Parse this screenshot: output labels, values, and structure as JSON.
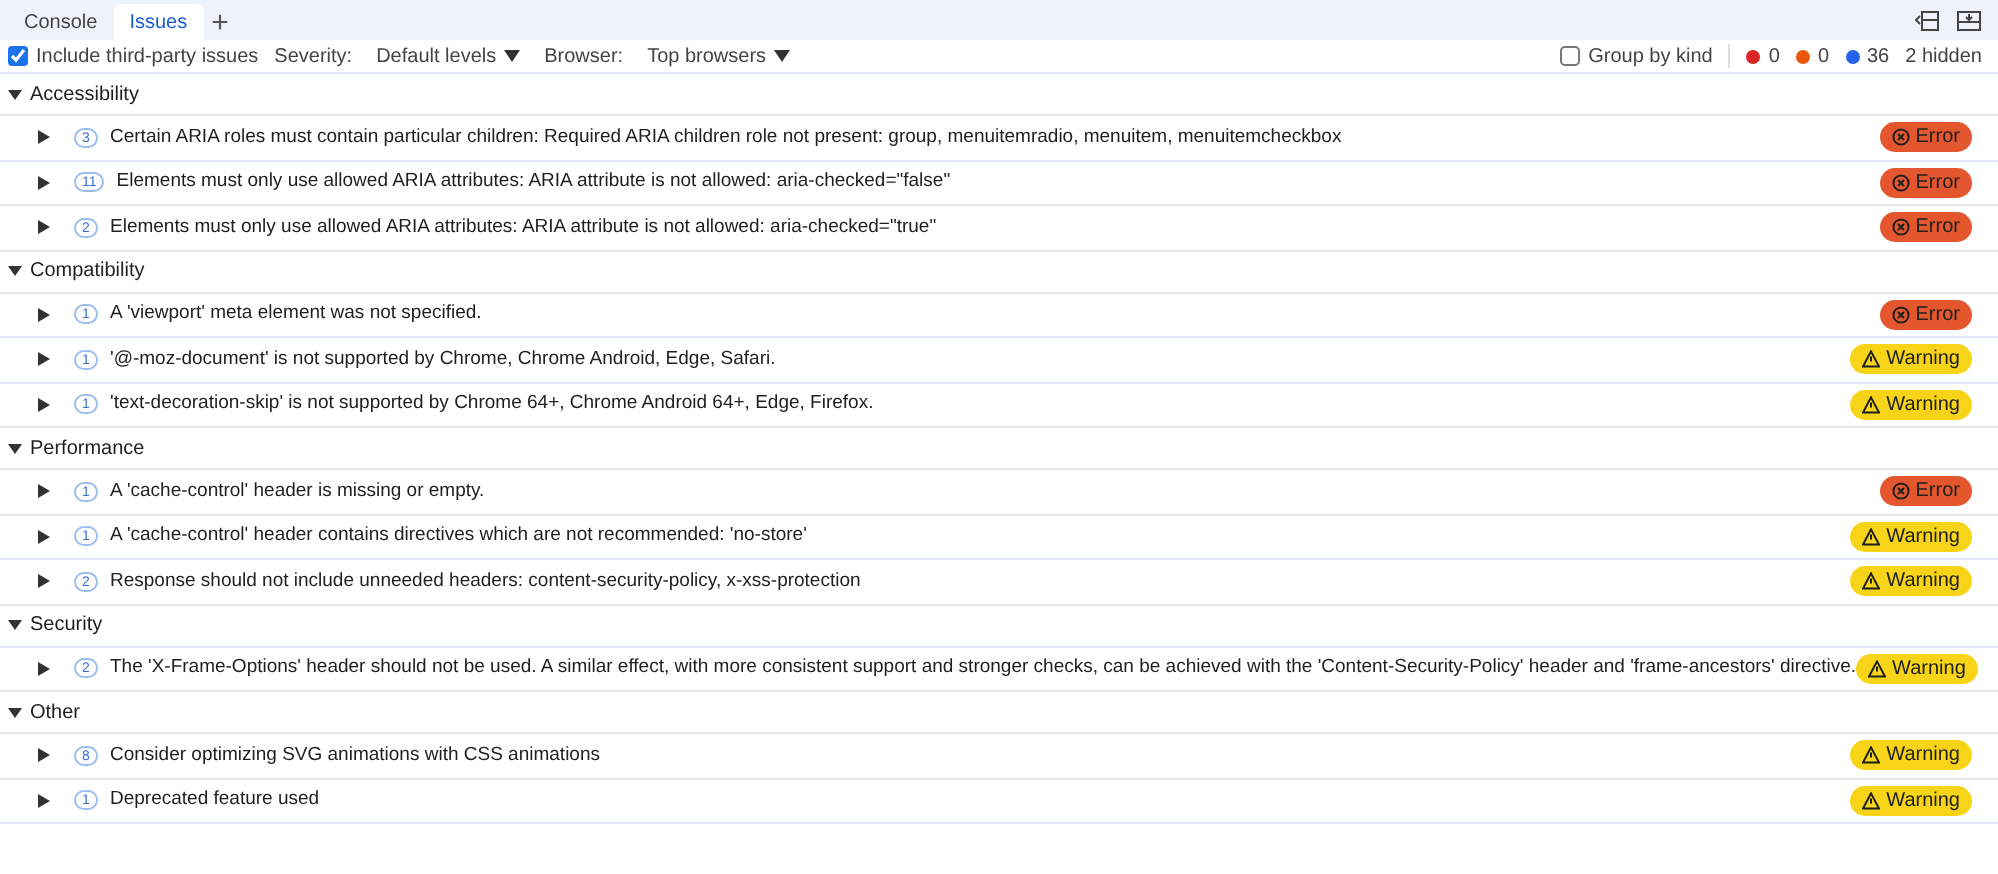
{
  "tabs": [
    {
      "label": "Console",
      "selected": false
    },
    {
      "label": "Issues",
      "selected": true
    }
  ],
  "new_tab": "+",
  "toolbar": {
    "include_third_party": {
      "label": "Include third-party issues",
      "checked": true
    },
    "severity_label": "Severity:",
    "severity_value": "Default levels",
    "browser_label": "Browser:",
    "browser_value": "Top browsers",
    "group_by_kind": {
      "label": "Group by kind",
      "checked": false
    },
    "counts": [
      {
        "color": "#dc2626",
        "value": "0"
      },
      {
        "color": "#ea580c",
        "value": "0"
      },
      {
        "color": "#2563eb",
        "value": "36"
      }
    ],
    "hidden": "2 hidden"
  },
  "categories": [
    {
      "name": "Accessibility",
      "expanded": true,
      "issues": [
        {
          "count": "3",
          "text": "Certain ARIA roles must contain particular children: Required ARIA children role not present: group, menuitemradio, menuitem, menuitemcheckbox",
          "kind": "error",
          "badge": "Error"
        },
        {
          "count": "11",
          "text": "Elements must only use allowed ARIA attributes: ARIA attribute is not allowed: aria-checked=\"false\"",
          "kind": "error",
          "badge": "Error"
        },
        {
          "count": "2",
          "text": "Elements must only use allowed ARIA attributes: ARIA attribute is not allowed: aria-checked=\"true\"",
          "kind": "error",
          "badge": "Error"
        }
      ]
    },
    {
      "name": "Compatibility",
      "expanded": true,
      "issues": [
        {
          "count": "1",
          "text": "A 'viewport' meta element was not specified.",
          "kind": "error",
          "badge": "Error"
        },
        {
          "count": "1",
          "text": "'@-moz-document' is not supported by Chrome, Chrome Android, Edge, Safari.",
          "kind": "warning",
          "badge": "Warning"
        },
        {
          "count": "1",
          "text": "'text-decoration-skip' is not supported by Chrome 64+, Chrome Android 64+, Edge, Firefox.",
          "kind": "warning",
          "badge": "Warning"
        }
      ]
    },
    {
      "name": "Performance",
      "expanded": true,
      "issues": [
        {
          "count": "1",
          "text": "A 'cache-control' header is missing or empty.",
          "kind": "error",
          "badge": "Error"
        },
        {
          "count": "1",
          "text": "A 'cache-control' header contains directives which are not recommended: 'no-store'",
          "kind": "warning",
          "badge": "Warning"
        },
        {
          "count": "2",
          "text": "Response should not include unneeded headers: content-security-policy, x-xss-protection",
          "kind": "warning",
          "badge": "Warning"
        }
      ]
    },
    {
      "name": "Security",
      "expanded": true,
      "issues": [
        {
          "count": "2",
          "text": "The 'X-Frame-Options' header should not be used. A similar effect, with more consistent support and stronger checks, can be achieved with the 'Content-Security-Policy' header and 'frame-ancestors' directive.",
          "kind": "warning",
          "badge": "Warning"
        }
      ]
    },
    {
      "name": "Other",
      "expanded": true,
      "issues": [
        {
          "count": "8",
          "text": "Consider optimizing SVG animations with CSS animations",
          "kind": "warning",
          "badge": "Warning"
        },
        {
          "count": "1",
          "text": "Deprecated feature used",
          "kind": "warning",
          "badge": "Warning"
        }
      ]
    }
  ]
}
